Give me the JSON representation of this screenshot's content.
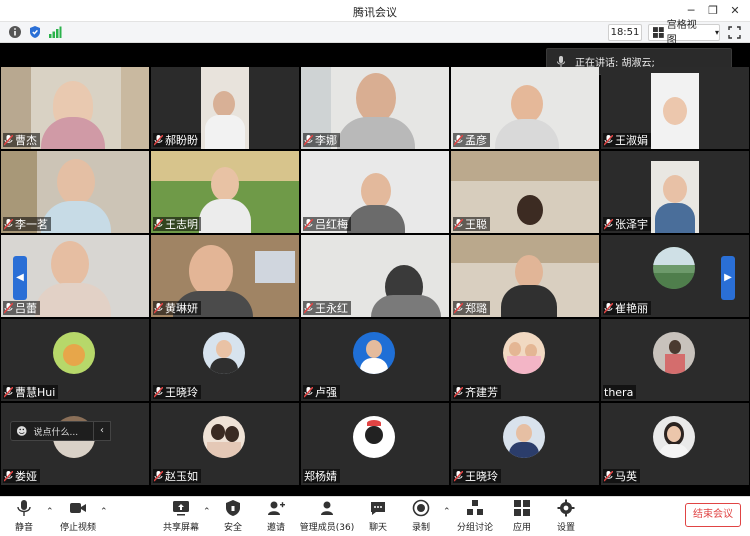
{
  "window": {
    "title": "腾讯会议"
  },
  "topbar": {
    "clock": "18:51",
    "view_label": "宫格视图"
  },
  "speaker": {
    "label": "正在讲话: 胡淑云;"
  },
  "participants": [
    "曹杰",
    "郝盼盼",
    "李娜",
    "孟彦",
    "王淑娟",
    "李一茗",
    "王志明",
    "吕红梅",
    "王聪",
    "张泽宇",
    "吕蕾",
    "黄琳妍",
    "王永红",
    "郑璐",
    "崔艳丽",
    "曹慧Hui",
    "王晓玲",
    "卢强",
    "齐建芳",
    "thera",
    "娄娅",
    "赵玉如",
    "郑杨婧",
    "王晓玲",
    "马英"
  ],
  "chat": {
    "placeholder": "说点什么..."
  },
  "controls": {
    "mute": "静音",
    "stop_video": "停止视频",
    "share": "共享屏幕",
    "security": "安全",
    "invite": "邀请",
    "members": "管理成员(36)",
    "chat": "聊天",
    "record": "录制",
    "breakout": "分组讨论",
    "apps": "应用",
    "settings": "设置",
    "end": "结束会议"
  },
  "colors": {
    "accent": "#2a6fd6",
    "end": "#e04444",
    "tile_bg": "#2b2b2b"
  }
}
